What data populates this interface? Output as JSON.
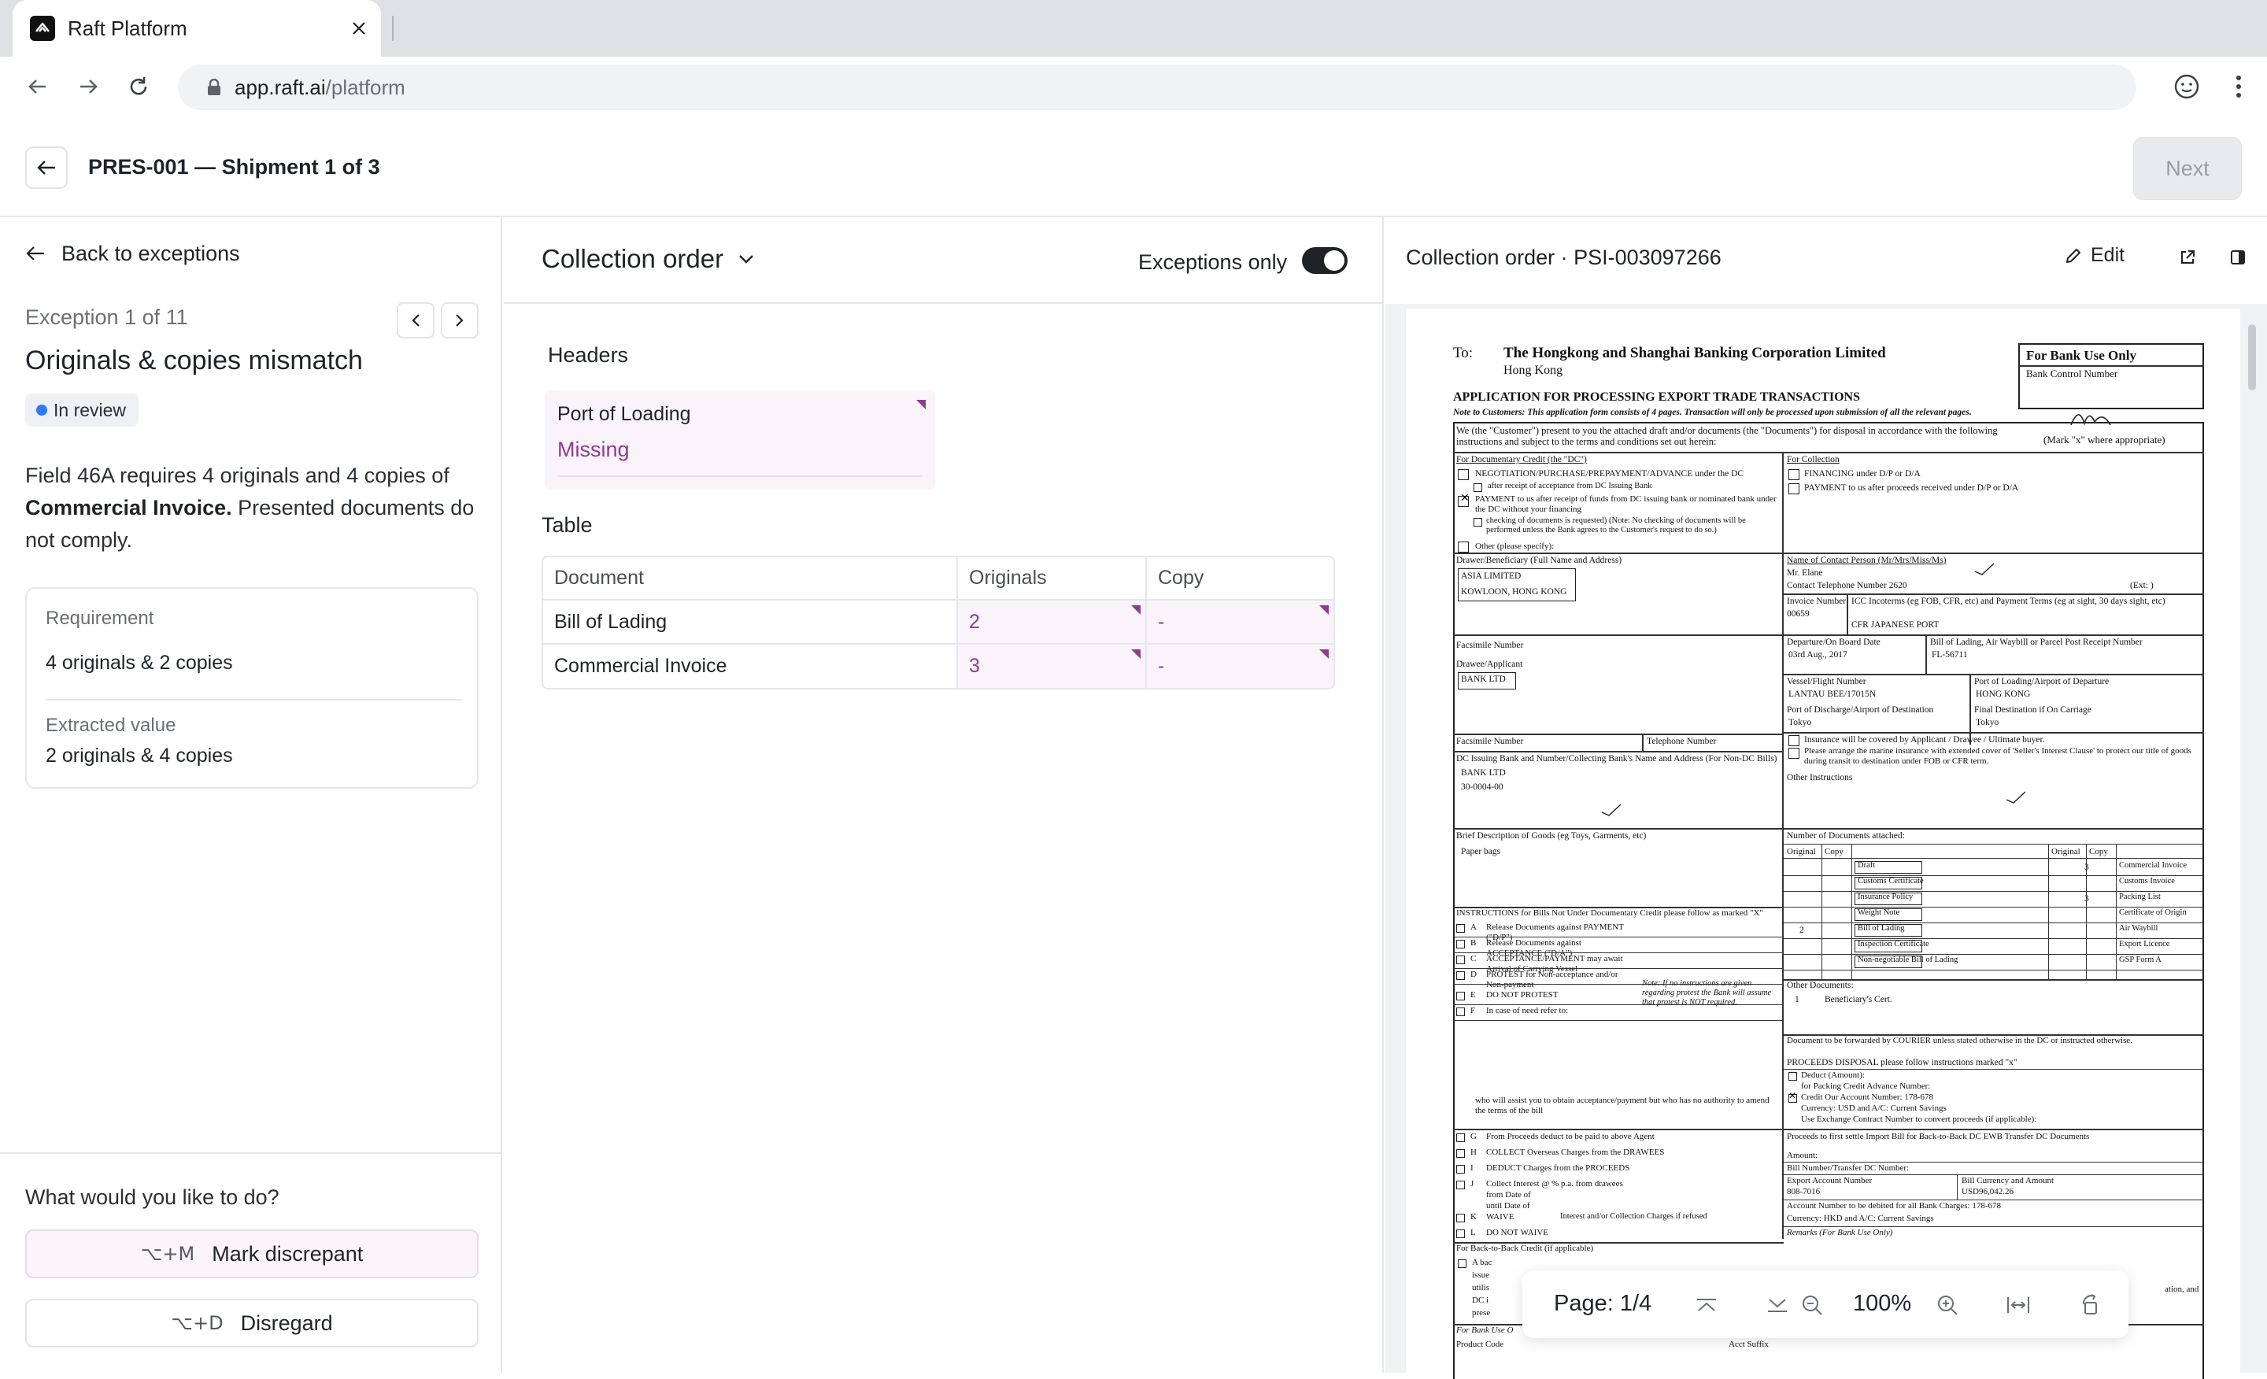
{
  "browser": {
    "tab_title": "Raft Platform",
    "url_host": "app.raft.ai",
    "url_path": "/platform"
  },
  "appbar": {
    "title": "PRES-001 — Shipment 1 of 3",
    "next_label": "Next"
  },
  "exception": {
    "back_label": "Back to exceptions",
    "counter": "Exception 1 of 11",
    "title": "Originals & copies mismatch",
    "status": "In review",
    "status_color": "#2f7bf6",
    "description_pre": "Field 46A requires 4 originals and 4 copies of ",
    "description_bold": "Commercial Invoice.",
    "description_post": " Presented documents do not comply.",
    "requirement_label": "Requirement",
    "requirement_value": "4 originals & 2 copies",
    "extracted_label": "Extracted value",
    "extracted_value": "2 originals & 4 copies"
  },
  "actions": {
    "question": "What would you like to do?",
    "mark_shortcut": "⌥+M",
    "mark_label": "Mark discrepant",
    "disregard_shortcut": "⌥+D",
    "disregard_label": "Disregard"
  },
  "middle": {
    "doc_type": "Collection order",
    "toggle_label": "Exceptions only",
    "toggle_on": true,
    "headers_heading": "Headers",
    "port_label": "Port of Loading",
    "port_value": "Missing",
    "table_heading": "Table",
    "table_columns": [
      "Document",
      "Originals",
      "Copy"
    ],
    "table_rows": [
      {
        "document": "Bill of Lading",
        "originals": "2",
        "copy": "-"
      },
      {
        "document": "Commercial Invoice",
        "originals": "3",
        "copy": "-"
      }
    ],
    "accent_color": "#8f3a95"
  },
  "viewer": {
    "title": "Collection order · PSI-003097266",
    "edit_label": "Edit",
    "page_indicator": "Page: 1/4",
    "zoom": "100%",
    "doc": {
      "to_label": "To:",
      "bank_name": "The Hongkong and Shanghai Banking Corporation Limited",
      "bank_city": "Hong Kong",
      "bank_use_title": "For Bank Use Only",
      "bank_control": "Bank Control Number",
      "app_title": "APPLICATION FOR PROCESSING EXPORT TRADE TRANSACTIONS",
      "note": "Note to Customers:   This application form consists of 4 pages.   Transaction will only be processed upon submission of all the relevant pages.",
      "intro": "We (the \"Customer\") present to you the attached draft and/or documents (the \"Documents\") for disposal in accordance with the following instructions and subject to the terms and conditions set out herein:",
      "mark_x": "(Mark \"x\" where appropriate)",
      "for_dc": "For Documentary Credit (the \"DC\")",
      "for_collection": "For Collection",
      "dc_opt1": "NEGOTIATION/PURCHASE/PREPAYMENT/ADVANCE under the DC",
      "dc_opt1b": "after receipt of acceptance from DC Issuing Bank",
      "dc_opt2": "PAYMENT to us after receipt of funds from DC issuing bank or nominated bank under the DC without your financing",
      "dc_opt2b": "checking of documents is requested) (Note: No checking of documents will be performed unless the Bank agrees to the Customer's request to do so.)",
      "dc_other": "Other (please specify):",
      "col_opt1": "FINANCING under D/P or D/A",
      "col_opt2": "PAYMENT to us after proceeds received under D/P or D/A",
      "drawer_label": "Drawer/Beneficiary (Full Name and Address)",
      "drawer_line1": "ASIA LIMITED",
      "drawer_line2": "KOWLOON, HONG KONG",
      "contact_label": "Name of Contact Person (Mr/Mrs/Miss/Ms)",
      "contact_name": "Mr. Elane",
      "telephone_label": "Contact Telephone Number 2620",
      "ext_label": "(Ext:       )",
      "invoice_label": "Invoice Number",
      "invoice_number": "00659",
      "incoterms_label": "ICC Incoterms (eg FOB, CFR, etc) and Payment Terms (eg at sight, 30 days sight, etc)",
      "incoterms_value": "CFR JAPANESE PORT",
      "facsimile_label": "Facsimile Number",
      "departure_label": "Departure/On Board Date",
      "departure_value": "03rd Aug., 2017",
      "bl_label": "Bill of Lading, Air Waybill or Parcel Post Receipt Number",
      "bl_value": "FL-56711",
      "drawee_label": "Drawee/Applicant",
      "drawee_value": "BANK LTD",
      "vessel_label": "Vessel/Flight Number",
      "vessel_value": "LANTAU BEE/17015N",
      "pol_label": "Port of Loading/Airport of Departure",
      "pol_value": "HONG KONG",
      "pod_label": "Port of Discharge/Airport of Destination",
      "pod_value": "Tokyo",
      "final_dest_label": "Final Destination if On Carriage",
      "final_dest_value": "Tokyo",
      "fax2_label": "Facsimile Number",
      "tel2_label": "Telephone Number",
      "insurance1": "Insurance will be covered by Applicant / Drawee / Ultimate buyer.",
      "insurance2": "Please arrange the marine insurance with extended cover of 'Seller's Interest Clause' to protect our title of goods during transit to destination under FOB or CFR term.",
      "dc_bank_label": "DC Issuing Bank and Number/Collecting Bank's Name and Address (For Non-DC Bills)",
      "dc_bank_value1": "BANK LTD",
      "dc_bank_value2": "30-0004-00",
      "other_instructions": "Other Instructions",
      "goods_label": "Brief Description of Goods (eg Toys, Garments, etc)",
      "goods_value": "Paper bags",
      "docs_attached": "Number of Documents attached:",
      "original": "Original",
      "copy": "Copy",
      "doc_list_left": [
        "Draft",
        "Customs Certificate",
        "Insurance Policy",
        "Weight Note",
        "Bill of Lading",
        "Inspection Certificate",
        "Non-negotiable Bill of Lading"
      ],
      "doc_list_right": [
        "Commercial Invoice",
        "Customs Invoice",
        "Packing List",
        "Certificate of Origin",
        "Air Waybill",
        "Export Licence",
        "GSP Form A"
      ],
      "instructions_header": "INSTRUCTIONS for Bills Not Under Documentary Credit please follow as marked \"X\"",
      "instr_items": [
        "Release Documents against PAYMENT (\"D/P\")",
        "Release Documents against ACCEPTANCE (\"D/A\")",
        "ACCEPTANCE/PAYMENT may await Arrival of Carrying Vessel",
        "PROTEST for Non-acceptance and/or Non-payment",
        "DO NOT PROTEST",
        "In case of need refer to:"
      ],
      "instr_letters": [
        "A",
        "B",
        "C",
        "D",
        "E",
        "F"
      ],
      "instr_note": "Note: If no instructions are given regarding protest the Bank will assume that protest is NOT required.",
      "other_docs": "Other Documents:",
      "other_docs_value": "Beneficiary's Cert.",
      "courier_text": "Document to be forwarded by COURIER unless stated otherwise in the DC or instructed otherwise.",
      "proceeds_header": "PROCEEDS DISPOSAL please follow instructions marked \"x\"",
      "deduct_label": "Deduct (Amount):",
      "packing_credit": "for Packing Credit Advance Number:",
      "credit_account": "Credit Our Account Number: 178-678",
      "currency_line": "Currency: USD     and A/C:     Current     Savings",
      "exchange_contract": "Use Exchange Contract Number to convert proceeds (if applicable):",
      "need_text": "who will assist you to obtain acceptance/payment but who has no authority to amend the terms of the bill",
      "g_text": "From Proceeds deduct            to be paid to above Agent",
      "h_text": "COLLECT Overseas Charges from the DRAWEES",
      "i_text": "DEDUCT Charges from the PROCEEDS",
      "j_text1": "Collect Interest @           % p.a. from drawees",
      "j_text2": "from Date of",
      "j_text3": "until Date of",
      "k_text": "WAIVE",
      "l_text": "DO NOT WAIVE",
      "kl_note": "Interest and/or Collection Charges if refused",
      "gl_letters": [
        "G",
        "H",
        "I",
        "J",
        "K",
        "L"
      ],
      "settle_text": "Proceeds to first settle Import Bill for     Back-to-Back DC     EWB     Transfer DC Documents",
      "amount_label": "Amount:",
      "bill_number_label": "Bill Number/Transfer DC Number:",
      "export_account_label": "Export Account Number",
      "export_account_value": "808-7016",
      "bill_currency_label": "Bill Currency and Amount",
      "bill_currency_value": "USD96,042.26",
      "debit_account": "Account Number to be debited for all Bank Charges: 178-678",
      "currency2": "Currency: HKD     and A/C:     Current     Savings",
      "remarks": "Remarks (For Bank Use Only)",
      "btb_label": "For Back-to-Back Credit (if applicable)",
      "btb_text": "A bac",
      "btb_rest": [
        "issue",
        "utilis",
        "DC i",
        "prese"
      ],
      "for_bank": "For Bank Use O",
      "product_code": "Product Code",
      "acct_suffix": "Acct Suffix",
      "right_edge_text": "ation, and"
    }
  }
}
